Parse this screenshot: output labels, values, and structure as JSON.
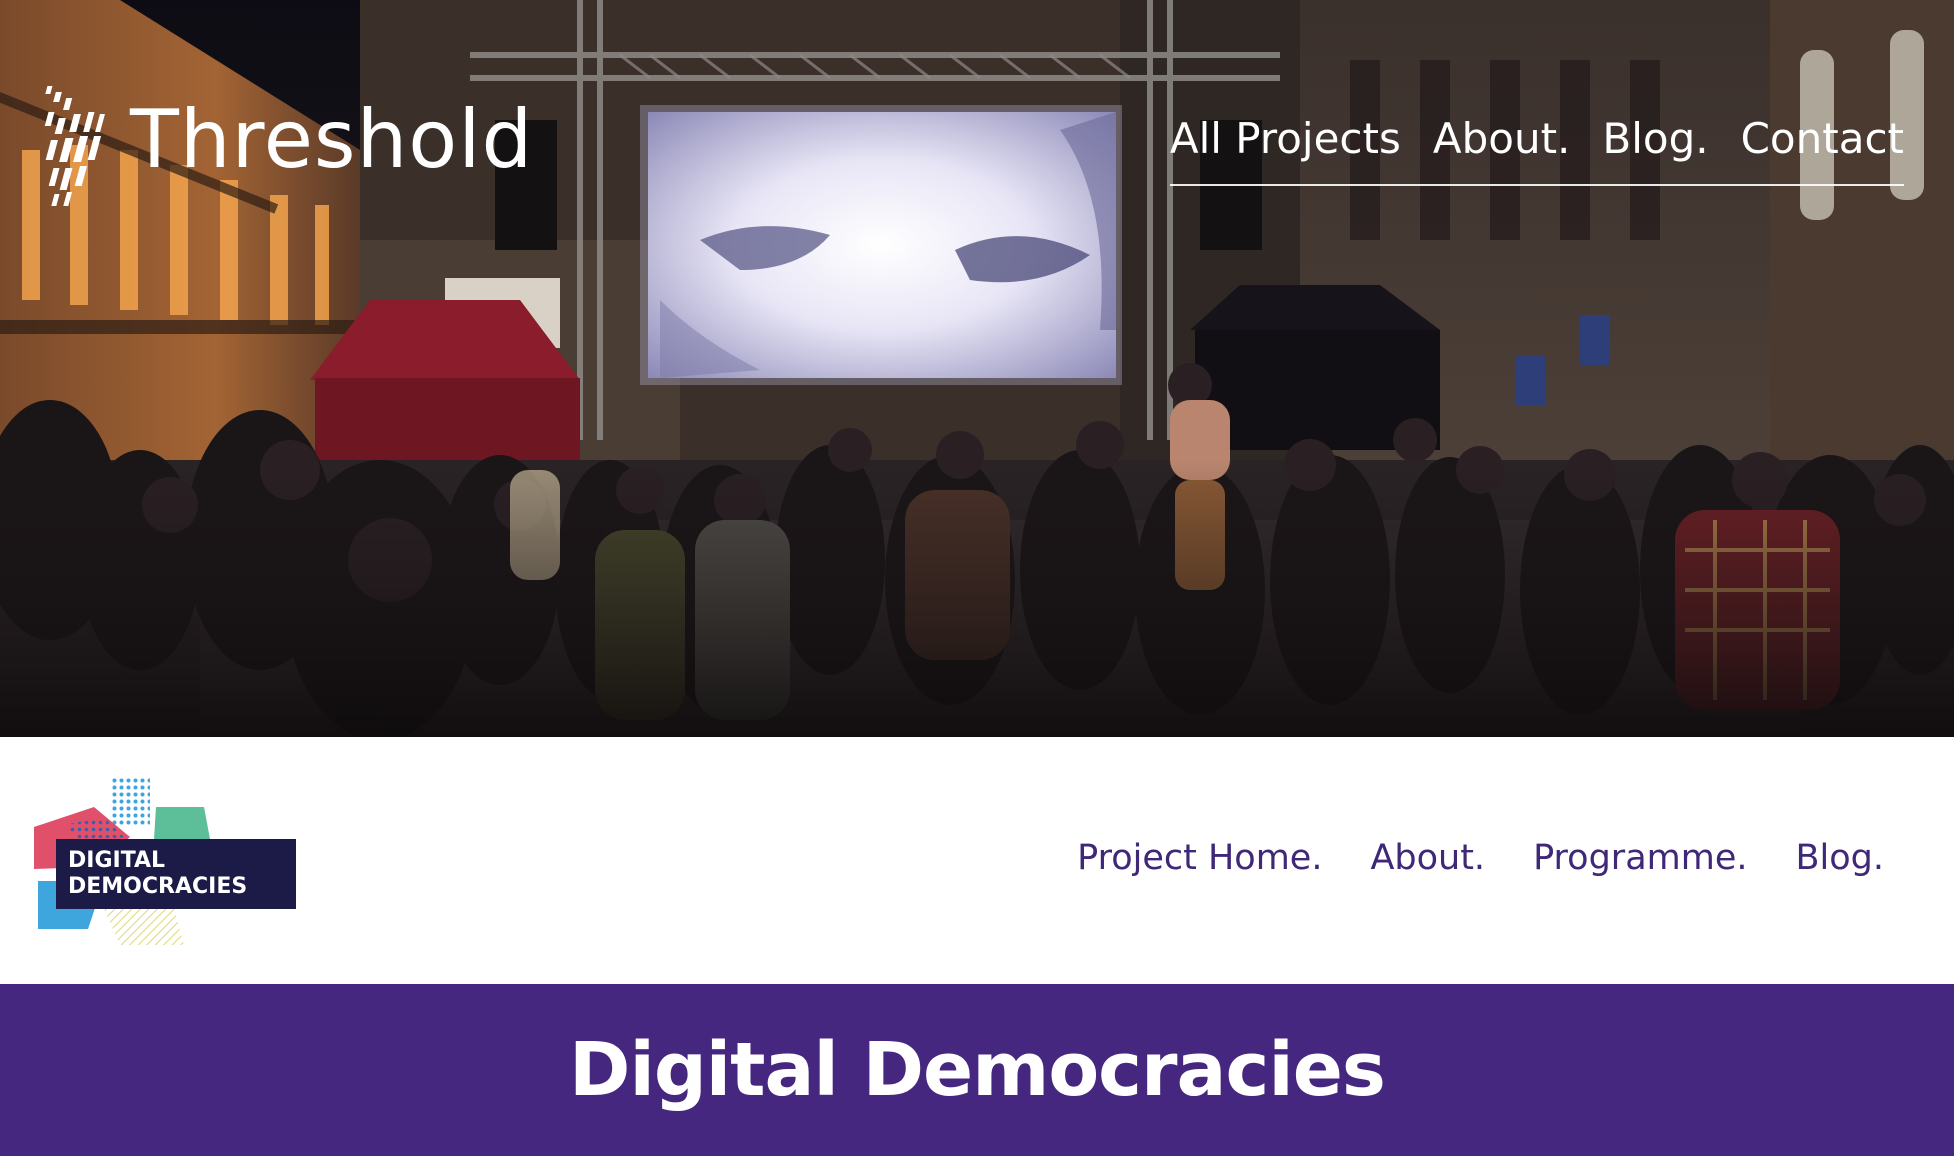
{
  "site": {
    "name": "Threshold",
    "nav": [
      {
        "label": "All Projects"
      },
      {
        "label": "About."
      },
      {
        "label": "Blog."
      },
      {
        "label": "Contact"
      }
    ]
  },
  "hero": {
    "image": "night-crowd-watching-outdoor-screen"
  },
  "project": {
    "logo_line1": "DIGITAL",
    "logo_line2": "DEMOCRACIES",
    "nav": [
      {
        "label": "Project Home."
      },
      {
        "label": "About."
      },
      {
        "label": "Programme."
      },
      {
        "label": "Blog."
      }
    ],
    "title": "Digital Democracies"
  },
  "colors": {
    "brand_purple": "#46277f",
    "nav_purple": "#3f2878",
    "logo_navy": "#1c1b47",
    "logo_pink": "#e0506a",
    "logo_blue": "#3ea6dc",
    "logo_green": "#5cbf9a",
    "logo_yellow": "#e6e38f"
  }
}
